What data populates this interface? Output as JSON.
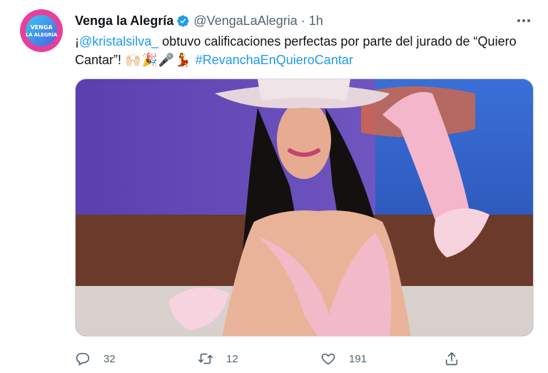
{
  "account": {
    "display_name": "Venga la Alegría",
    "handle": "@VengaLaAlegria",
    "separator": "·",
    "time": "1h",
    "avatar_line1": "VENGA",
    "avatar_line2": "LA ALEGRÍA"
  },
  "tweet": {
    "text_prefix": "¡",
    "mention": "@kristalsilva_",
    "text_main": " obtuvo calificaciones perfectas por parte del jurado de “Quiero Cantar”! ",
    "emojis": "🙌🏻🎉🎤💃",
    "hashtag": "#RevanchaEnQuieroCantar"
  },
  "actions": {
    "replies": "32",
    "retweets": "12",
    "likes": "191"
  },
  "icons": {
    "verified": "verified-badge-icon",
    "more": "more-icon",
    "reply": "reply-icon",
    "retweet": "retweet-icon",
    "like": "heart-icon",
    "share": "share-icon"
  },
  "colors": {
    "accent": "#1d9bf0",
    "secondary_text": "#536471"
  }
}
